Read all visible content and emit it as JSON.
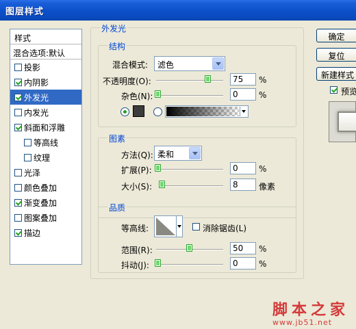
{
  "window": {
    "title": "图层样式"
  },
  "style_list": {
    "header": "样式",
    "blending": "混合选项:默认",
    "items": [
      {
        "label": "投影",
        "checked": false
      },
      {
        "label": "内阴影",
        "checked": true
      },
      {
        "label": "外发光",
        "checked": true,
        "selected": true
      },
      {
        "label": "内发光",
        "checked": false
      },
      {
        "label": "斜面和浮雕",
        "checked": true
      },
      {
        "label": "等高线",
        "checked": false,
        "indent": true
      },
      {
        "label": "纹理",
        "checked": false,
        "indent": true
      },
      {
        "label": "光泽",
        "checked": false
      },
      {
        "label": "颜色叠加",
        "checked": false
      },
      {
        "label": "渐变叠加",
        "checked": true
      },
      {
        "label": "图案叠加",
        "checked": false
      },
      {
        "label": "描边",
        "checked": true
      }
    ]
  },
  "outer_glow": {
    "title": "外发光",
    "structure": {
      "title": "结构",
      "blend_mode_label": "混合模式:",
      "blend_mode_value": "滤色",
      "opacity_label": "不透明度(O):",
      "opacity_value": "75",
      "opacity_unit": "%",
      "noise_label": "杂色(N):",
      "noise_value": "0",
      "noise_unit": "%",
      "color_swatch": "#3c3c3c"
    },
    "elements": {
      "title": "图素",
      "technique_label": "方法(Q):",
      "technique_value": "柔和",
      "spread_label": "扩展(P):",
      "spread_value": "0",
      "spread_unit": "%",
      "size_label": "大小(S):",
      "size_value": "8",
      "size_unit": "像素"
    },
    "quality": {
      "title": "品质",
      "contour_label": "等高线:",
      "antialias_label": "消除锯齿(L)",
      "range_label": "范围(R):",
      "range_value": "50",
      "range_unit": "%",
      "jitter_label": "抖动(J):",
      "jitter_value": "0",
      "jitter_unit": "%"
    }
  },
  "buttons": {
    "ok": "确定",
    "reset": "复位",
    "new_style": "新建样式",
    "preview_label": "预览"
  },
  "watermark": {
    "line1": "脚本之家",
    "line2": "www.jb51.net"
  }
}
